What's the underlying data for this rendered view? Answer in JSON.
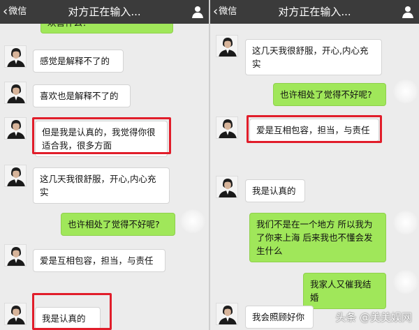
{
  "left": {
    "nav": {
      "back_label": "微信",
      "title": "对方正在输入..."
    },
    "top_fragment": "欢喜什么？",
    "messages": [
      {
        "text": "感觉是解释不了的"
      },
      {
        "text": "喜欢也是解释不了的"
      },
      {
        "text": "但是我是认真的，我觉得你很适合我，很多方面"
      },
      {
        "text": "这几天我很舒服，开心,内心充实"
      },
      {
        "text": "也许相处了觉得不好呢?"
      },
      {
        "text": "爱是互相包容，担当，与责任"
      },
      {
        "text": "我是认真的"
      }
    ]
  },
  "right": {
    "nav": {
      "back_label": "微信",
      "title": "对方正在输入..."
    },
    "messages": [
      {
        "text": "这几天我很舒服，开心,内心充实"
      },
      {
        "text": "也许相处了觉得不好呢?"
      },
      {
        "text": "爱是互相包容，担当，与责任"
      },
      {
        "text": "我是认真的"
      },
      {
        "text": "我们不是在一个地方 所以我为了你来上海 后来我也不懂会发生什么"
      },
      {
        "text": "我家人又催我结婚"
      },
      {
        "text": "我会照顾好你"
      }
    ]
  },
  "watermark": "头条 @美美娱网",
  "colors": {
    "topbar": "#3b3b3b",
    "my_bubble": "#a0e75a",
    "highlight": "#e11d2a",
    "background": "#ececec"
  }
}
